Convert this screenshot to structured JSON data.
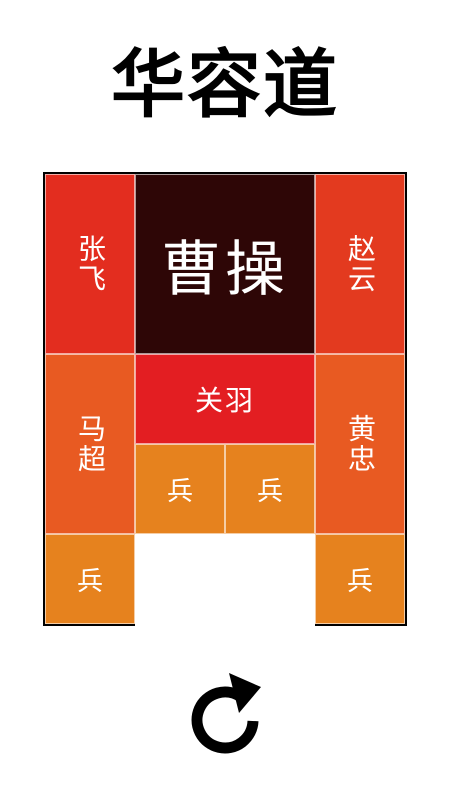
{
  "title": "华容道",
  "colors": {
    "boss": "#2e0606",
    "general_red": "#e32d1f",
    "general_orange": "#e85a22",
    "guan_yu": "#e31e22",
    "soldier": "#e6821e"
  },
  "pieces": {
    "zhang_fei": "张飞",
    "cao_cao": "曹操",
    "zhao_yun": "赵云",
    "guan_yu": "关羽",
    "ma_chao": "马超",
    "huang_zhong": "黄忠",
    "soldier": "兵"
  },
  "reset_icon": "refresh-icon"
}
